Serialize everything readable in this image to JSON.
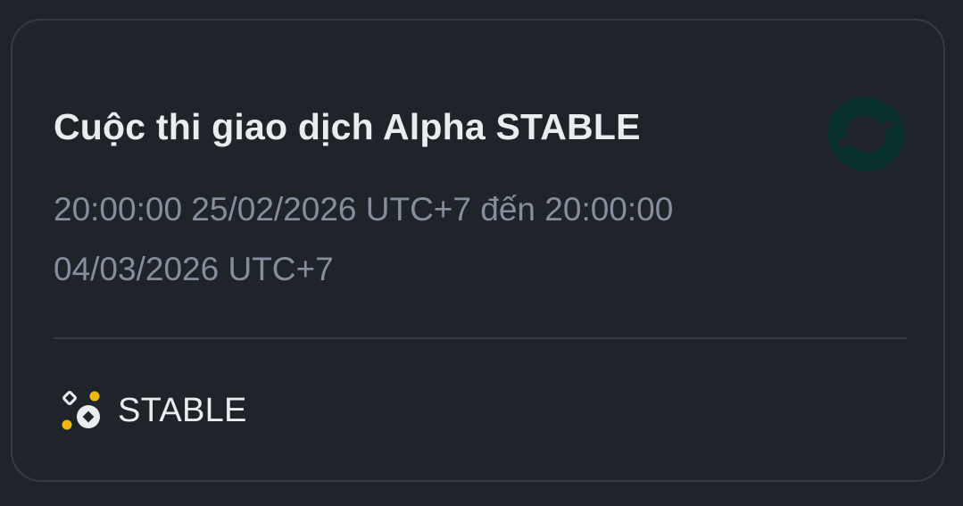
{
  "competition": {
    "title": "Cuộc thi giao dịch Alpha STABLE",
    "time_range": "20:00:00 25/02/2026 UTC+7 đến 20:00:00 04/03/2026 UTC+7"
  },
  "token": {
    "symbol": "STABLE",
    "logo_icon": "stable-token-logo-icon",
    "alpha_icon": "binance-alpha-icon"
  },
  "colors": {
    "background": "#1f242b",
    "title": "#eaecef",
    "secondary_text": "#848e9c",
    "alpha_yellow": "#f0b90b",
    "logo_teal": "#08302b"
  }
}
